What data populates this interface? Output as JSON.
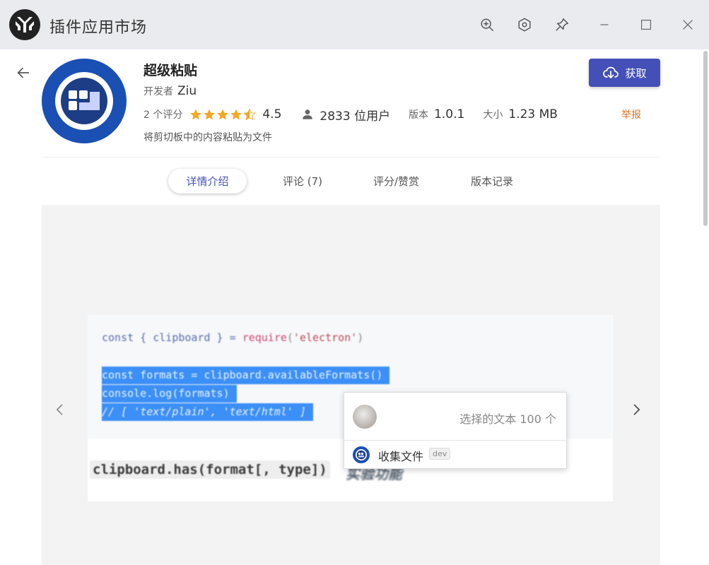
{
  "window": {
    "title": "插件应用市场",
    "toolbar_icons": [
      "zoom-in-icon",
      "settings-hex-icon",
      "pin-icon",
      "minimize-icon",
      "maximize-icon",
      "close-icon"
    ]
  },
  "plugin": {
    "name": "超级粘贴",
    "developer_label": "开发者",
    "developer": "Ziu",
    "ratings_count": "2 个评分",
    "rating": "4.5",
    "rating_value": 4.5,
    "users": "2833 位用户",
    "version_label": "版本",
    "version": "1.0.1",
    "size_label": "大小",
    "size": "1.23 MB",
    "description": "将剪切板中的内容粘贴为文件",
    "get_label": "获取",
    "report_label": "举报"
  },
  "tabs": [
    {
      "label": "详情介绍",
      "active": true
    },
    {
      "label": "评论 (7)",
      "active": false
    },
    {
      "label": "评分/赞赏",
      "active": false
    },
    {
      "label": "版本记录",
      "active": false
    }
  ],
  "gallery": {
    "code_lines": [
      {
        "parts": [
          "const { clipboard } = ",
          "require",
          "(",
          "'electron'",
          ")"
        ]
      },
      {
        "text": "const formats = clipboard.availableFormats()"
      },
      {
        "text": "console.log(formats)"
      },
      {
        "text": "// [ 'text/plain', 'text/html' ]"
      }
    ],
    "api_line": "clipboard.has(format[, type])",
    "api_cn": "实验功能",
    "popup": {
      "selected_text": "选择的文本 100 个",
      "item_label": "收集文件",
      "item_badge": "dev"
    }
  },
  "colors": {
    "accent": "#4450b8",
    "star": "#f5a623",
    "report": "#d4762c",
    "plugin_logo_blue": "#1a4fb3"
  }
}
